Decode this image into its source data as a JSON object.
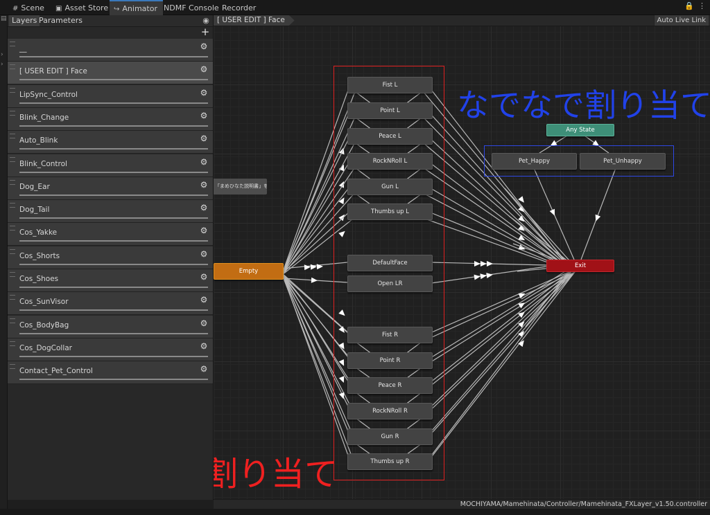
{
  "tabs": [
    {
      "label": "Scene",
      "icon": "grid-icon"
    },
    {
      "label": "Asset Store",
      "icon": "store-bag-icon"
    },
    {
      "label": "Animator",
      "icon": "animator-icon",
      "active": true
    },
    {
      "label": "NDMF Console",
      "icon": ""
    },
    {
      "label": "Recorder",
      "icon": ""
    }
  ],
  "left_panel": {
    "tabs": [
      "Layers",
      "Parameters"
    ],
    "layers": [
      "__",
      "[ USER EDIT ] Face",
      "LipSync_Control",
      "Blink_Change",
      "Auto_Blink",
      "Blink_Control",
      "Dog_Ear",
      "Dog_Tail",
      "Cos_Yakke",
      "Cos_Shorts",
      "Cos_Shoes",
      "Cos_SunVisor",
      "Cos_BodyBag",
      "Cos_DogCollar",
      "Contact_Pet_Control"
    ],
    "selected_layer": "[ USER EDIT ] Face"
  },
  "graph": {
    "breadcrumb": "[ USER EDIT ] Face",
    "auto_live_link": "Auto Live Link",
    "note": "「まめひなた説明書」をご参照ください。",
    "states": {
      "empty": "Empty",
      "left": [
        "Fist L",
        "Point L",
        "Peace L",
        "RockNRoll L",
        "Gun L",
        "Thumbs up L"
      ],
      "middle": [
        "DefaultFace",
        "Open LR"
      ],
      "right": [
        "Fist R",
        "Point R",
        "Peace R",
        "RockNRoll R",
        "Gun R",
        "Thumbs up R"
      ],
      "any_state": "Any State",
      "pet": [
        "Pet_Happy",
        "Pet_Unhappy"
      ],
      "exit": "Exit"
    },
    "annotations": {
      "pet_label": "なでなで割り当て",
      "face_label": "表情割り当て",
      "face_box_color": "#e02020",
      "pet_box_color": "#2e48e6"
    }
  },
  "status": {
    "path": "MOCHIYAMA/Mamehinata/Controller/Mamehinata_FXLayer_v1.50.controller"
  },
  "colors": {
    "empty_state": "#c26d13",
    "any_state": "#3e8f78",
    "exit_state": "#a11117",
    "tab_accent": "#3a79bb"
  }
}
